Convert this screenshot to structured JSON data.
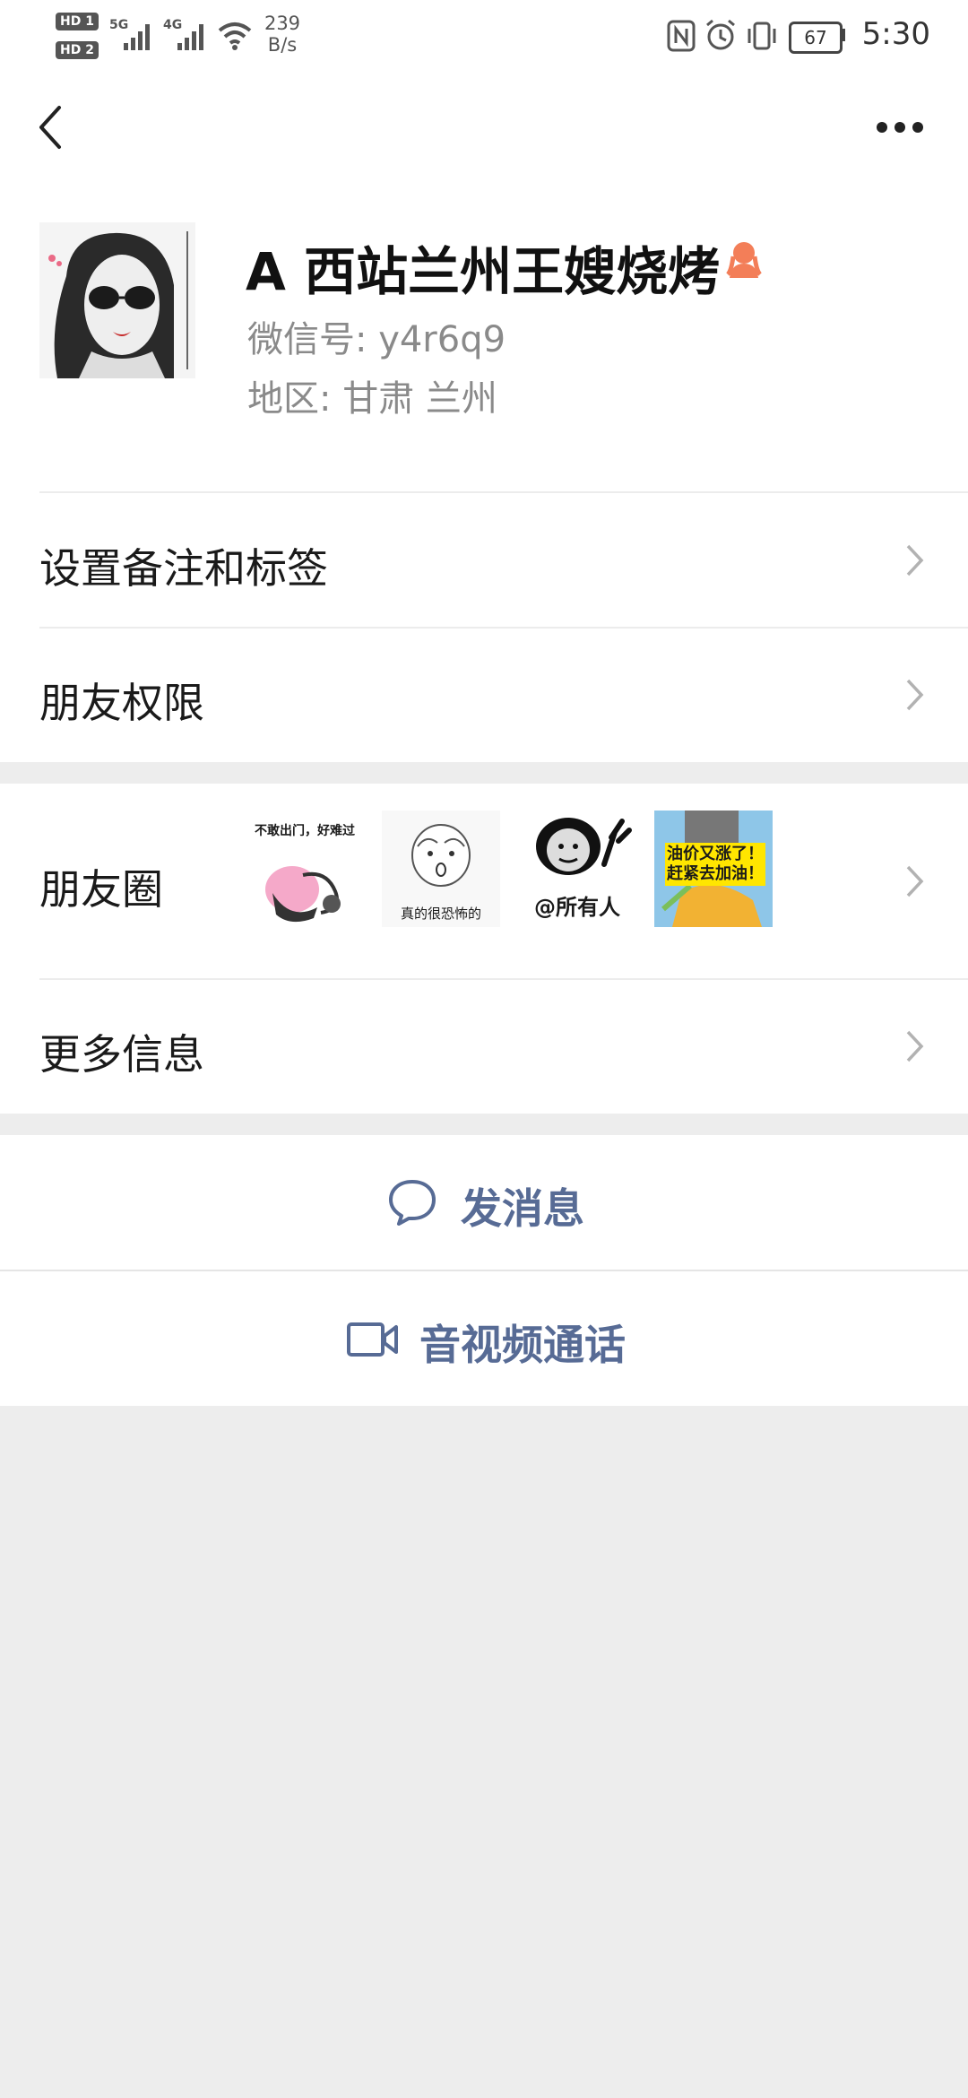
{
  "status_bar": {
    "hd1": "HD 1",
    "hd2": "HD 2",
    "net1": "5G",
    "net2": "4G",
    "speed_value": "239",
    "speed_unit": "B/s",
    "battery": "67",
    "time": "5:30"
  },
  "nav": {
    "back_icon": "back-chevron",
    "more_icon": "more-dots"
  },
  "profile": {
    "name": "A 西站兰州王嫂烧烤",
    "gender_icon": "female-icon",
    "gender_color": "#f37e58",
    "wechat_id": "微信号:  y4r6q9",
    "region": "地区:  甘肃  兰州"
  },
  "menu": {
    "remark_label": "设置备注和标签",
    "permissions_label": "朋友权限",
    "moments_label": "朋友圈",
    "more_info_label": "更多信息"
  },
  "moments": {
    "thumbs": [
      {
        "caption": "不敢出门，好难过"
      },
      {
        "caption": "真的很恐怖的"
      },
      {
        "caption": "@所有人"
      },
      {
        "caption": "油价又涨了！赶紧去加油！"
      }
    ]
  },
  "actions": {
    "message_label": "发消息",
    "message_icon": "chat-bubble-icon",
    "call_label": "音视频通话",
    "call_icon": "video-camera-icon",
    "accent_color": "#576b95"
  }
}
